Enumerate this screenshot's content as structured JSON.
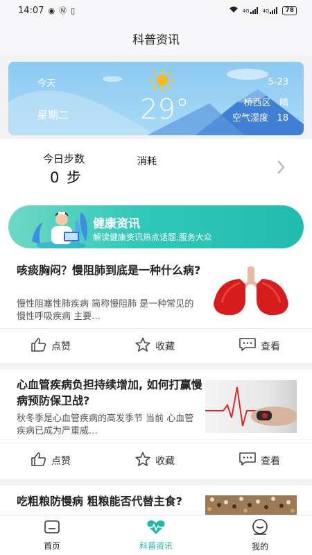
{
  "status_bar": {
    "time": "14:07",
    "battery": "78",
    "signal_1": "4G",
    "signal_2": "4G"
  },
  "header": {
    "title": "科普资讯"
  },
  "weather": {
    "today_label": "今天",
    "weekday": "星期二",
    "temperature": "29°",
    "date": "5-23",
    "location": "桥西区",
    "condition": "晴",
    "humidity_label": "空气湿度",
    "humidity_value": "18"
  },
  "steps": {
    "label": "今日步数",
    "value": "0 步",
    "burn_label": "消耗"
  },
  "banner": {
    "title": "健康资讯",
    "subtitle": "解读健康资讯热点话题,服务大众"
  },
  "articles": [
    {
      "title": "咳痰胸闷？慢阻肺到底是一种什么病?",
      "desc": "慢性阻塞性肺疾病 简称慢阻肺 是一种常见的慢性呼吸疾病 主要…",
      "image": "lungs-illustration"
    },
    {
      "title": "心血管疾病负担持续增加, 如何打赢慢病预防保卫战?",
      "desc": "秋冬季是心血管疾病的高发季节 当前 心血管疾病已成为严重威…",
      "image": "heartbeat-photo"
    },
    {
      "title": "吃粗粮防慢病 粗粮能否代替主食?",
      "desc": "",
      "image": "grains-photo"
    }
  ],
  "actions": {
    "like": "点赞",
    "favorite": "收藏",
    "view": "查看"
  },
  "tabbar": {
    "items": [
      {
        "label": "首页",
        "icon": "home-icon"
      },
      {
        "label": "科普资讯",
        "icon": "heart-pulse-icon"
      },
      {
        "label": "我的",
        "icon": "user-icon"
      }
    ],
    "active_color": "#1fb4a8"
  }
}
